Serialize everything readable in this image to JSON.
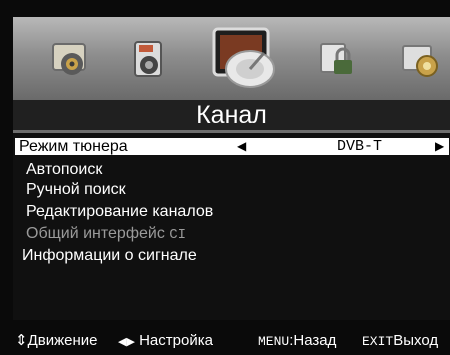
{
  "menu": {
    "title": "Канал",
    "icons": [
      "picture-icon",
      "sound-icon",
      "channel-satellite-icon",
      "lock-icon",
      "setup-icon"
    ],
    "selected_icon": "channel-satellite-icon",
    "items": [
      {
        "label": "Режим тюнера",
        "value": "DVB-T",
        "selected": true
      },
      {
        "label": "Автопоиск"
      },
      {
        "label": "Ручной поиск"
      },
      {
        "label": "Редактирование каналов"
      },
      {
        "label": "Общий интерфейс",
        "suffix": "CI",
        "disabled": true
      },
      {
        "label": "Информации о сигнале"
      }
    ]
  },
  "footer": {
    "move_label": "Движение",
    "adjust_label": "Настройка",
    "menu_key": "MENU",
    "menu_action": ":Назад",
    "exit_key": "EXIT",
    "exit_action": "Выход"
  },
  "colors": {
    "background": "#0a0a0a",
    "highlight": "#ffffff",
    "disabled_text": "#9a9a9a"
  }
}
